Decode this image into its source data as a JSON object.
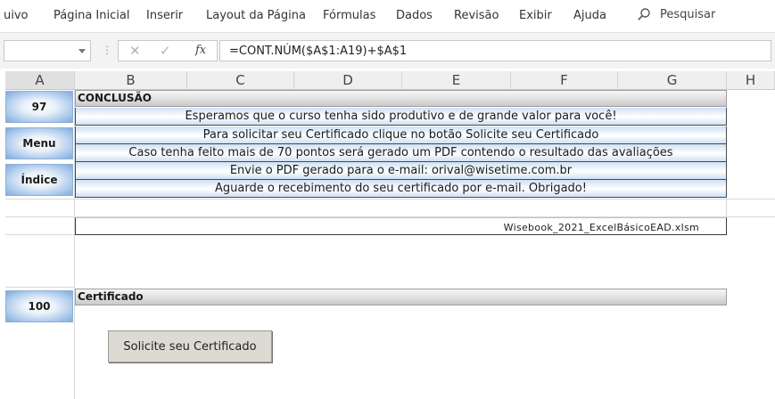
{
  "ribbon": {
    "tabs": [
      "uivo",
      "Página Inicial",
      "Inserir",
      "Layout da Página",
      "Fórmulas",
      "Dados",
      "Revisão",
      "Exibir",
      "Ajuda"
    ],
    "search_label": "Pesquisar"
  },
  "formula_bar": {
    "name_box": "",
    "formula": "=CONT.NÚM($A$1:A19)+$A$1"
  },
  "columns": [
    "A",
    "B",
    "C",
    "D",
    "E",
    "F",
    "G",
    "H"
  ],
  "nav_buttons": {
    "num_top": "97",
    "menu": "Menu",
    "index": "Índice",
    "num_bottom": "100"
  },
  "conclusion": {
    "header": "CONCLUSÃO",
    "lines": [
      "Esperamos que o curso tenha sido produtivo e de grande valor para você!",
      "Para solicitar seu Certificado clique no botão Solicite seu Certificado",
      "Caso tenha feito mais de 70 pontos será gerado um PDF contendo o resultado das avaliações",
      "Envie o PDF gerado para o e-mail: orival@wisetime.com.br",
      "Aguarde o recebimento do seu certificado por e-mail. Obrigado!"
    ],
    "filename": "Wisebook_2021_ExcelBásicoEAD.xlsm"
  },
  "certificate": {
    "header": "Certificado",
    "button_label": "Solicite seu Certificado"
  }
}
